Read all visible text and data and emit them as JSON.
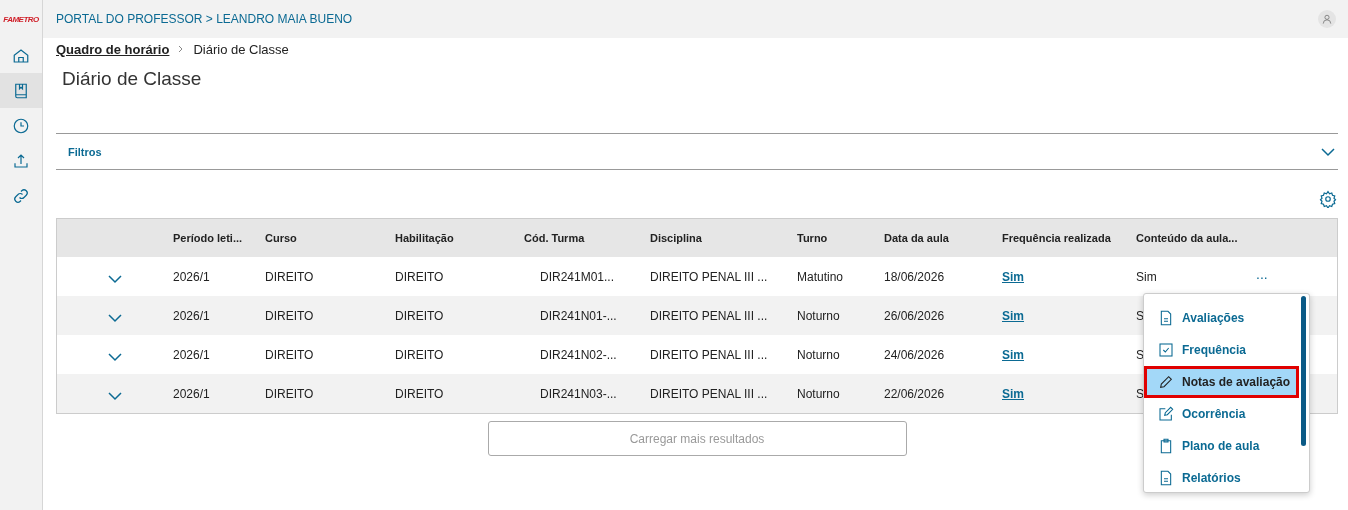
{
  "logo": "FAMETRO",
  "sidebar": {
    "items": [
      {
        "selected": false
      },
      {
        "selected": true
      },
      {
        "selected": false
      },
      {
        "selected": false
      },
      {
        "selected": false
      }
    ]
  },
  "header": {
    "title": "PORTAL DO PROFESSOR > LEANDRO MAIA BUENO"
  },
  "breadcrumb": [
    "Quadro de horário",
    "Diário de Classe"
  ],
  "page_title": "Diário de Classe",
  "filters": {
    "label": "Filtros",
    "expanded": false
  },
  "table": {
    "columns": [
      "Período leti...",
      "Curso",
      "Habilitação",
      "Cód. Turma",
      "Disciplina",
      "Turno",
      "Data da aula",
      "Frequência realizada",
      "Conteúdo da aula..."
    ],
    "rows": [
      {
        "cells": [
          "2026/1",
          "DIREITO",
          "DIREITO",
          "DIR241M01...",
          "DIREITO PENAL III ...",
          "Matutino",
          "18/06/2026",
          "Sim",
          "Sim"
        ],
        "more_button": "..."
      },
      {
        "cells": [
          "2026/1",
          "DIREITO",
          "DIREITO",
          "DIR241N01-...",
          "DIREITO PENAL III ...",
          "Noturno",
          "26/06/2026",
          "Sim",
          "S"
        ]
      },
      {
        "cells": [
          "2026/1",
          "DIREITO",
          "DIREITO",
          "DIR241N02-...",
          "DIREITO PENAL III ...",
          "Noturno",
          "24/06/2026",
          "Sim",
          "S"
        ]
      },
      {
        "cells": [
          "2026/1",
          "DIREITO",
          "DIREITO",
          "DIR241N03-...",
          "DIREITO PENAL III ...",
          "Noturno",
          "22/06/2026",
          "Sim",
          "S"
        ]
      }
    ]
  },
  "load_more": {
    "label": "Carregar mais resultados",
    "disabled": true
  },
  "menu": {
    "items": [
      {
        "label": "Avaliações",
        "selected": false
      },
      {
        "label": "Frequência",
        "selected": false
      },
      {
        "label": "Notas de avaliação",
        "selected": true
      },
      {
        "label": "Ocorrência",
        "selected": false
      },
      {
        "label": "Plano de aula",
        "selected": false
      },
      {
        "label": "Relatórios",
        "selected": false
      }
    ]
  }
}
